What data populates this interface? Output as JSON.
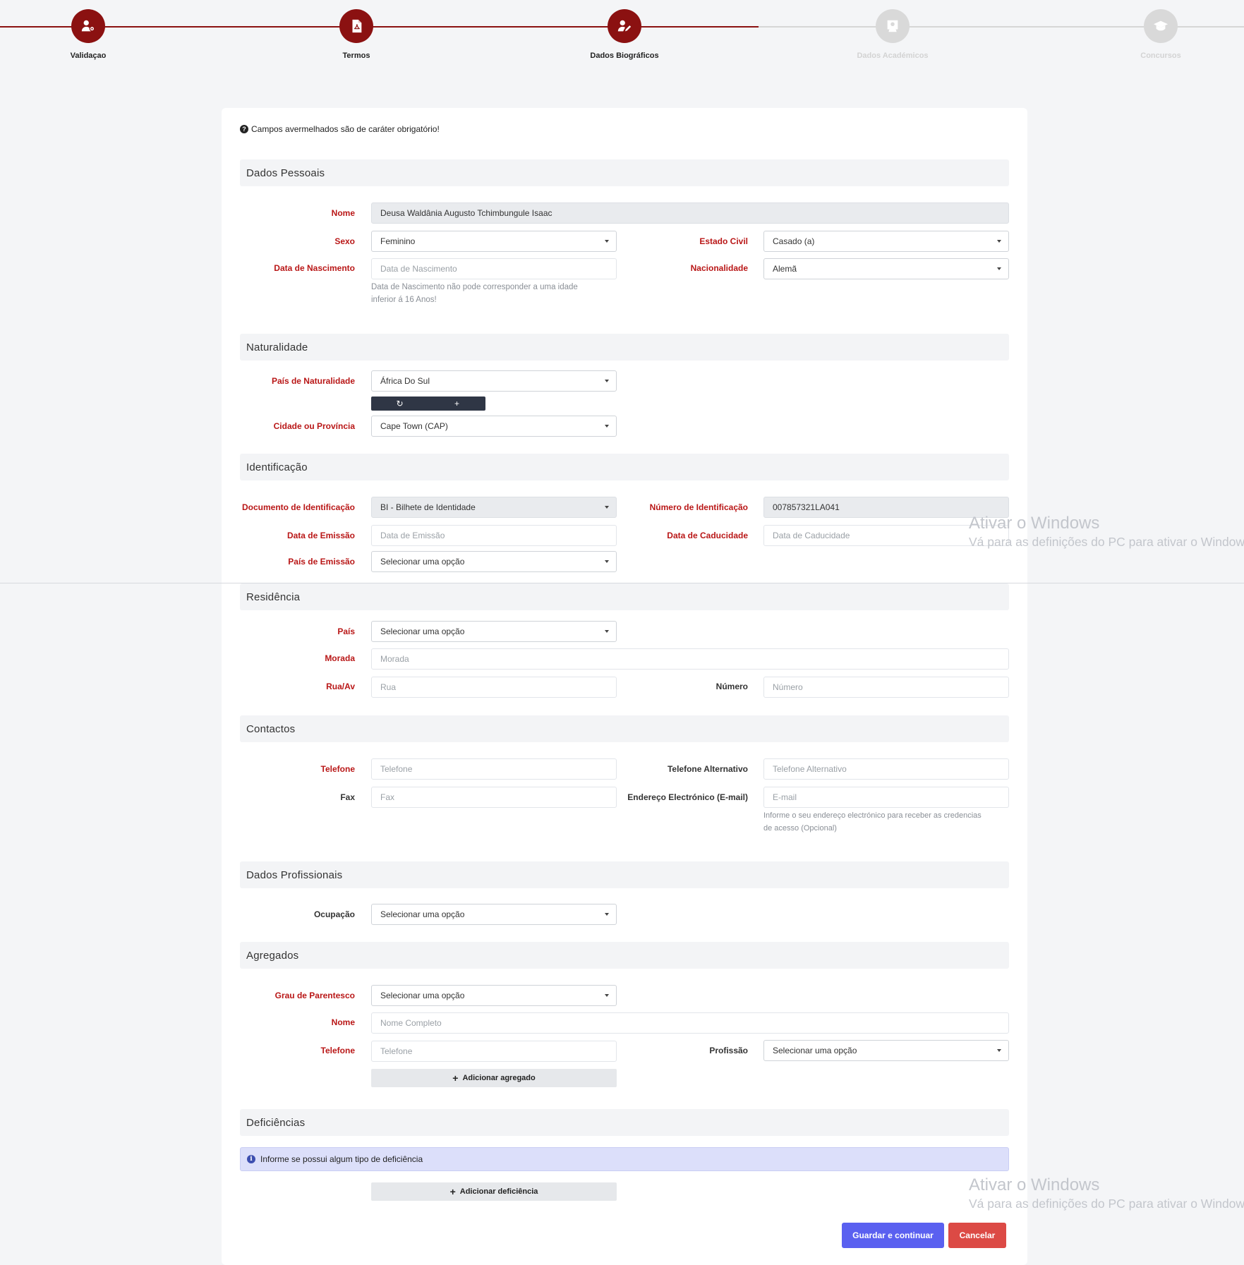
{
  "stepper": {
    "steps": [
      {
        "label": "Validaçao",
        "state": "done",
        "icon": "user-gear-icon"
      },
      {
        "label": "Termos",
        "state": "done",
        "icon": "pdf-document-icon"
      },
      {
        "label": "Dados Biográficos",
        "state": "done",
        "icon": "user-edit-icon"
      },
      {
        "label": "Dados Académicos",
        "state": "todo",
        "icon": "teacher-icon"
      },
      {
        "label": "Concursos",
        "state": "todo",
        "icon": "graduation-cap-icon"
      }
    ],
    "colors": {
      "active": "#8b1111",
      "inactive": "#d9d9d9"
    }
  },
  "notice": "Campos avermelhados são de caráter obrigatório!",
  "sections": {
    "pessoais": "Dados Pessoais",
    "naturalidade": "Naturalidade",
    "identificacao": "Identificação",
    "residencia": "Residência",
    "contactos": "Contactos",
    "profissionais": "Dados Profissionais",
    "agregados": "Agregados",
    "deficiencias": "Deficiências"
  },
  "pessoais": {
    "nome_label": "Nome",
    "nome_value": "Deusa Waldânia Augusto Tchimbungule Isaac",
    "sexo_label": "Sexo",
    "sexo_value": "Feminino",
    "estado_civil_label": "Estado Civil",
    "estado_civil_value": "Casado (a)",
    "nascimento_label": "Data de Nascimento",
    "nascimento_placeholder": "Data de Nascimento",
    "nascimento_help_1": "Data de Nascimento não pode corresponder a uma idade",
    "nascimento_help_2": "inferior á 16 Anos!",
    "nacionalidade_label": "Nacionalidade",
    "nacionalidade_value": "Alemã"
  },
  "naturalidade": {
    "pais_label": "País de Naturalidade",
    "pais_value": "África Do Sul",
    "refresh_icon": "↻",
    "add_icon": "+",
    "cidade_label": "Cidade ou Província",
    "cidade_value": "Cape Town (CAP)"
  },
  "identificacao": {
    "documento_label": "Documento de Identificação",
    "documento_value": "BI - Bilhete de Identidade",
    "numero_label": "Número de Identificação",
    "numero_value": "007857321LA041",
    "emissao_label": "Data de Emissão",
    "emissao_placeholder": "Data de Emissão",
    "caducidade_label": "Data de Caducidade",
    "caducidade_placeholder": "Data de Caducidade",
    "pais_emissao_label": "País de Emissão",
    "pais_emissao_value": "Selecionar uma opção"
  },
  "residencia": {
    "pais_label": "País",
    "pais_value": "Selecionar uma opção",
    "morada_label": "Morada",
    "morada_placeholder": "Morada",
    "rua_label": "Rua/Av",
    "rua_placeholder": "Rua",
    "numero_label": "Número",
    "numero_placeholder": "Número"
  },
  "contactos": {
    "telefone_label": "Telefone",
    "telefone_placeholder": "Telefone",
    "alt_label": "Telefone Alternativo",
    "alt_placeholder": "Telefone Alternativo",
    "fax_label": "Fax",
    "fax_placeholder": "Fax",
    "email_label": "Endereço Electrónico (E-mail)",
    "email_placeholder": "E-mail",
    "email_help_1": "Informe o seu endereço electrónico para receber as credencias",
    "email_help_2": "de acesso (Opcional)"
  },
  "profissionais": {
    "ocupacao_label": "Ocupação",
    "ocupacao_value": "Selecionar uma opção"
  },
  "agregados": {
    "grau_label": "Grau de Parentesco",
    "grau_value": "Selecionar uma opção",
    "nome_label": "Nome",
    "nome_placeholder": "Nome Completo",
    "telefone_label": "Telefone",
    "telefone_placeholder": "Telefone",
    "profissao_label": "Profissão",
    "profissao_value": "Selecionar uma opção",
    "add_button": "Adicionar agregado"
  },
  "deficiencias": {
    "info": "Informe se possui algum tipo de deficiência",
    "add_button": "Adicionar deficiência"
  },
  "actions": {
    "save": "Guardar e continuar",
    "cancel": "Cancelar"
  },
  "watermark": {
    "title": "Ativar o Windows",
    "subtitle": "Vá para as definições do PC para ativar o Windows."
  },
  "colors": {
    "required_label": "#b91717",
    "primary_button": "#5a60f0",
    "danger_button": "#dc4a45",
    "info_alert": "#dcdffa"
  }
}
